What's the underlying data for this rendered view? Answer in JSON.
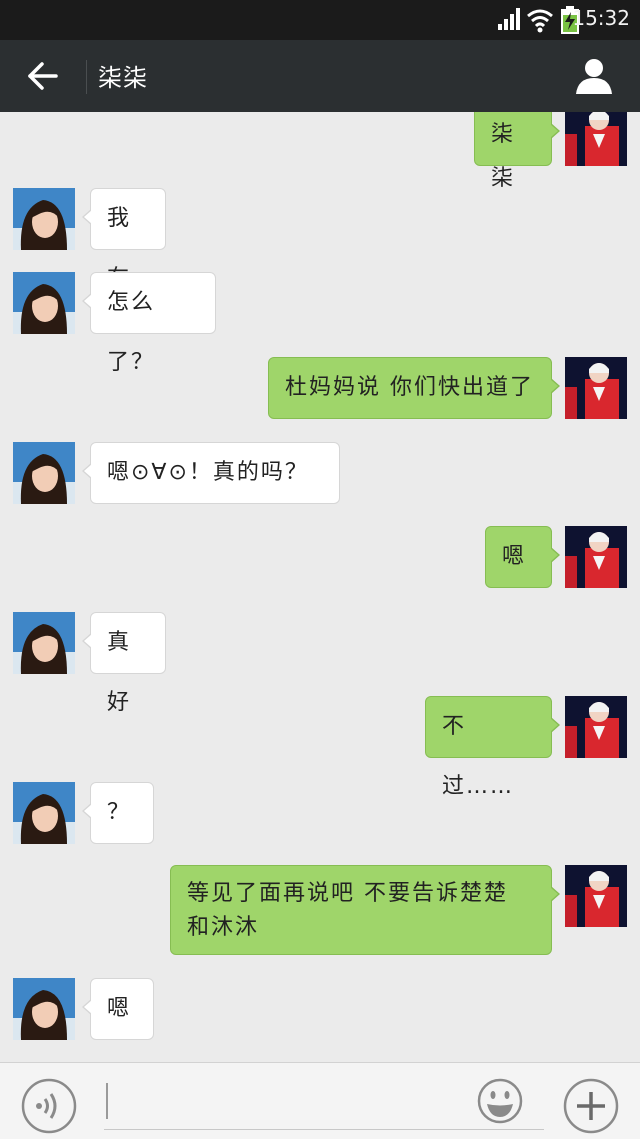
{
  "status_bar": {
    "time": "15:32",
    "icons": [
      "signal-icon",
      "wifi-icon",
      "battery-charging-icon"
    ]
  },
  "header": {
    "title": "柒柒",
    "back_icon": "arrow-left-icon",
    "profile_icon": "person-icon"
  },
  "messages": [
    {
      "side": "right",
      "text": "柒柒"
    },
    {
      "side": "left",
      "text": "我在"
    },
    {
      "side": "left",
      "text": "怎么了？"
    },
    {
      "side": "right",
      "text": "杜妈妈说 你们快出道了"
    },
    {
      "side": "left",
      "text": "嗯⊙∀⊙！真的吗？"
    },
    {
      "side": "right",
      "text": "嗯"
    },
    {
      "side": "left",
      "text": "真好"
    },
    {
      "side": "right",
      "text": "不过……"
    },
    {
      "side": "left",
      "text": "？"
    },
    {
      "side": "right",
      "text": "等见了面再说吧 不要告诉楚楚",
      "text2": "和沐沐"
    },
    {
      "side": "left",
      "text": "嗯"
    }
  ],
  "input_bar": {
    "voice_icon": "voice-icon",
    "input_value": "",
    "emoji_icon": "emoji-icon",
    "plus_icon": "plus-icon"
  },
  "colors": {
    "header_bg": "#2b2f31",
    "chat_bg": "#ebebeb",
    "sent_bubble": "#9fd56a",
    "received_bubble": "#ffffff"
  }
}
